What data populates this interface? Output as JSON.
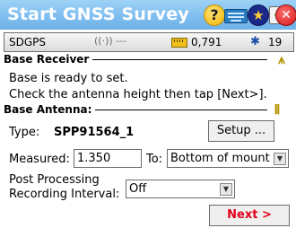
{
  "title": "Start GNSS Survey",
  "titlebar_icons": {
    "help": "?",
    "ok": "✓",
    "star": "★",
    "close": "✕"
  },
  "status": {
    "mode": "SDGPS",
    "signal": "((·)) ---",
    "precision": "0,791",
    "satellites": "19"
  },
  "base_receiver": {
    "label": "Base Receiver",
    "message_line1": "Base is ready to set.",
    "message_line2": "Check the antenna height then tap [Next>]."
  },
  "base_antenna": {
    "label": "Base Antenna:",
    "type_label": "Type:",
    "type_value": "SPP91564_1",
    "setup_label": "Setup ...",
    "measured_label": "Measured:",
    "measured_value": "1.350",
    "to_label": "To:",
    "to_value": "Bottom of mount"
  },
  "post_processing": {
    "label_line1": "Post Processing",
    "label_line2": "Recording Interval:",
    "value": "Off"
  },
  "next_label": "Next >",
  "colors": {
    "titlebar": "#7dbcee",
    "next_text": "#e0001a"
  }
}
